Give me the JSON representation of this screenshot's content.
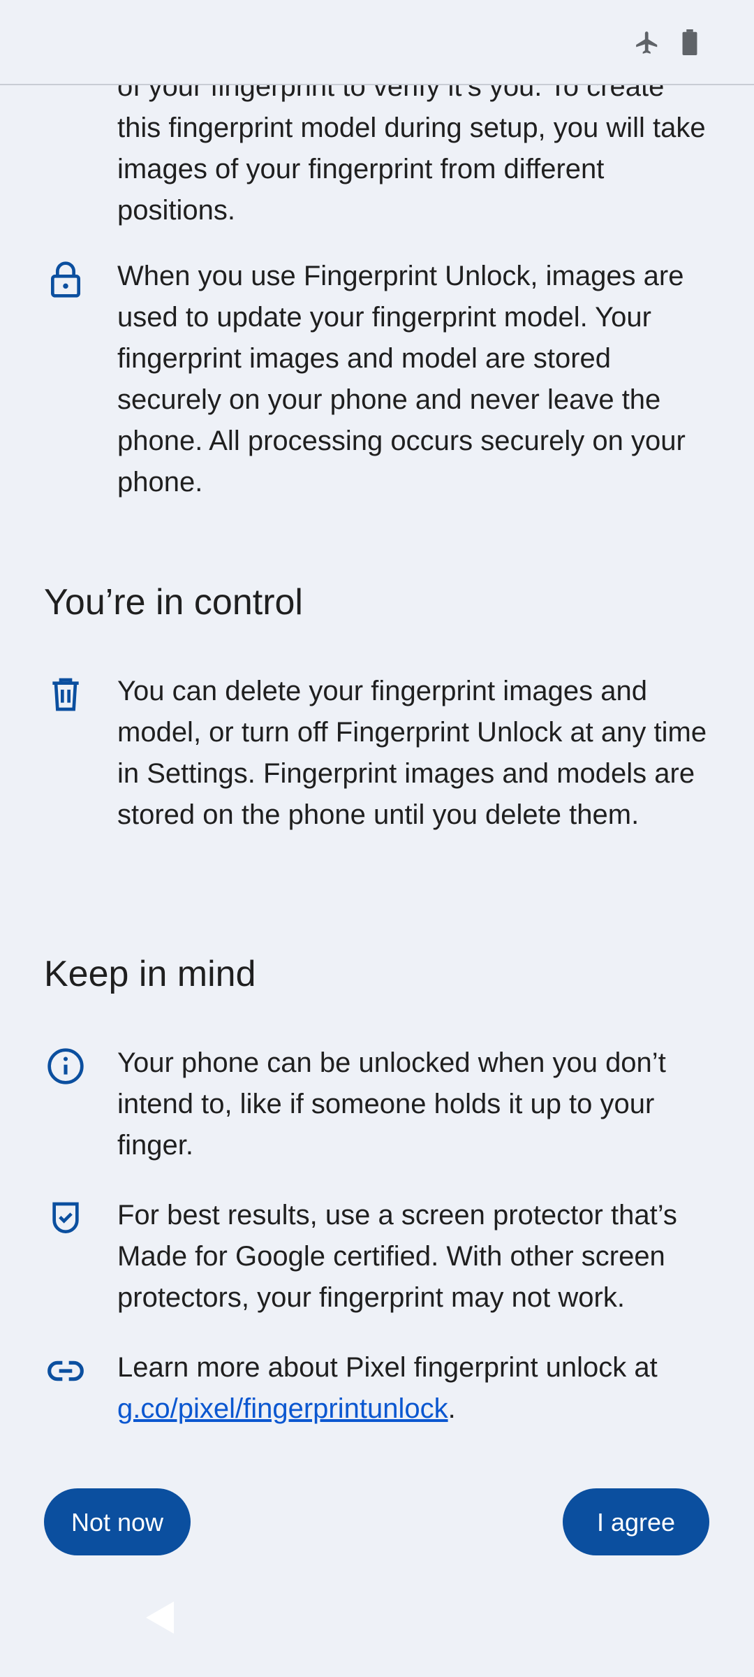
{
  "status_bar": {
    "icons": [
      "airplane-icon",
      "battery-icon"
    ]
  },
  "items": [
    {
      "icon": "none",
      "text": "of your fingerprint to verify it’s you. To create this fingerprint model during setup, you will take images of your fingerprint from different positions."
    },
    {
      "icon": "lock-icon",
      "text": "When you use Fingerprint Unlock, images are used to update your fingerprint model. Your fingerprint images and model are stored securely on your phone and never leave the phone. All processing occurs securely on your phone."
    }
  ],
  "sections": [
    {
      "title": "You’re in control",
      "items": [
        {
          "icon": "trash-icon",
          "text": "You can delete your fingerprint images and model, or turn off Fingerprint Unlock at any time in Settings. Fingerprint images and models are stored on the phone until you delete them."
        }
      ]
    },
    {
      "title": "Keep in mind",
      "items": [
        {
          "icon": "info-icon",
          "text": "Your phone can be unlocked when you don’t intend to, like if someone holds it up to your finger."
        },
        {
          "icon": "shield-check-icon",
          "text": "For best results, use a screen protector that’s Made for Google certified. With other screen protectors, your fingerprint may not work."
        },
        {
          "icon": "link-icon",
          "text_prefix": "Learn more about Pixel fingerprint unlock at ",
          "link_text": "g.co/pixel/fingerprintunlock",
          "text_suffix": "."
        }
      ]
    }
  ],
  "buttons": {
    "not_now": "Not now",
    "agree": "I agree"
  },
  "colors": {
    "background": "#eef1f7",
    "accent": "#0b4f9f",
    "link": "#0b57d0",
    "text": "#1f1f1f"
  },
  "nav": {
    "icons": [
      "back-icon"
    ]
  }
}
